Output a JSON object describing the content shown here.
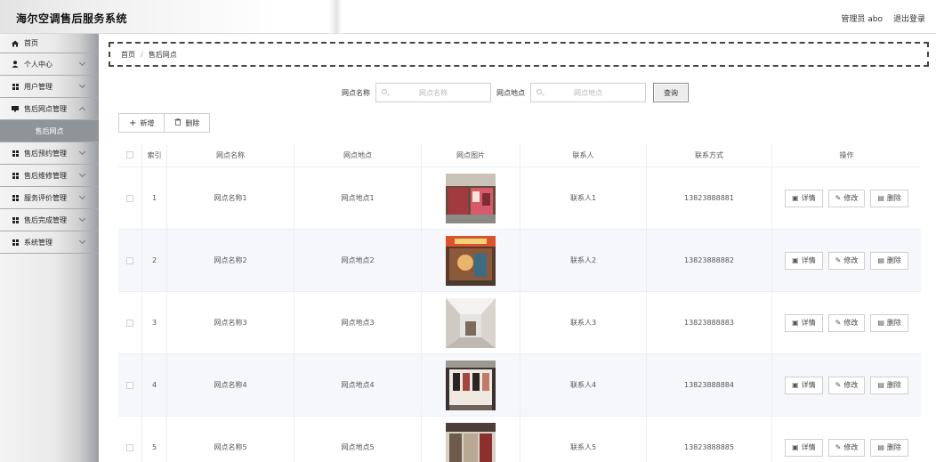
{
  "app": {
    "title": "海尔空调售后服务系统"
  },
  "header": {
    "user_label": "管理员 abo",
    "logout_label": "退出登录"
  },
  "sidebar": {
    "items": [
      {
        "label": "首页",
        "icon": "home-icon"
      },
      {
        "label": "个人中心",
        "icon": "user-icon"
      },
      {
        "label": "用户管理",
        "icon": "grid-icon"
      },
      {
        "label": "售后网点管理",
        "icon": "monitor-icon"
      },
      {
        "label": "售后网点",
        "icon": ""
      },
      {
        "label": "售后预约管理",
        "icon": "grid-icon"
      },
      {
        "label": "售后维修管理",
        "icon": "grid-icon"
      },
      {
        "label": "服务评价管理",
        "icon": "grid-icon"
      },
      {
        "label": "售后完成管理",
        "icon": "grid-icon"
      },
      {
        "label": "系统管理",
        "icon": "grid-icon"
      }
    ]
  },
  "breadcrumb": {
    "home": "首页",
    "separator": "/",
    "current": "售后网点"
  },
  "search": {
    "name_label": "网点名称",
    "name_placeholder": "网点名称",
    "address_label": "网点地点",
    "address_placeholder": "网点地点",
    "query_label": "查询"
  },
  "toolbar": {
    "add_label": "新增",
    "delete_label": "删除"
  },
  "table": {
    "headers": {
      "index": "索引",
      "name": "网点名称",
      "address": "网点地点",
      "image": "网点图片",
      "contact": "联系人",
      "phone": "联系方式",
      "ops": "操作"
    },
    "ops_labels": {
      "detail": "详情",
      "edit": "修改",
      "delete": "删除"
    },
    "rows": [
      {
        "index": "1",
        "name": "网点名称1",
        "address": "网点地点1",
        "contact": "联系人1",
        "phone": "13823888881"
      },
      {
        "index": "2",
        "name": "网点名称2",
        "address": "网点地点2",
        "contact": "联系人2",
        "phone": "13823888882"
      },
      {
        "index": "3",
        "name": "网点名称3",
        "address": "网点地点3",
        "contact": "联系人3",
        "phone": "13823888883"
      },
      {
        "index": "4",
        "name": "网点名称4",
        "address": "网点地点4",
        "contact": "联系人4",
        "phone": "13823888884"
      },
      {
        "index": "5",
        "name": "网点名称5",
        "address": "网点地点5",
        "contact": "联系人5",
        "phone": "13823888885"
      }
    ]
  },
  "colors": {
    "sidebar_active": "#8f9499",
    "row_alt": "#f5f7fa",
    "border": "#ebeef5"
  }
}
